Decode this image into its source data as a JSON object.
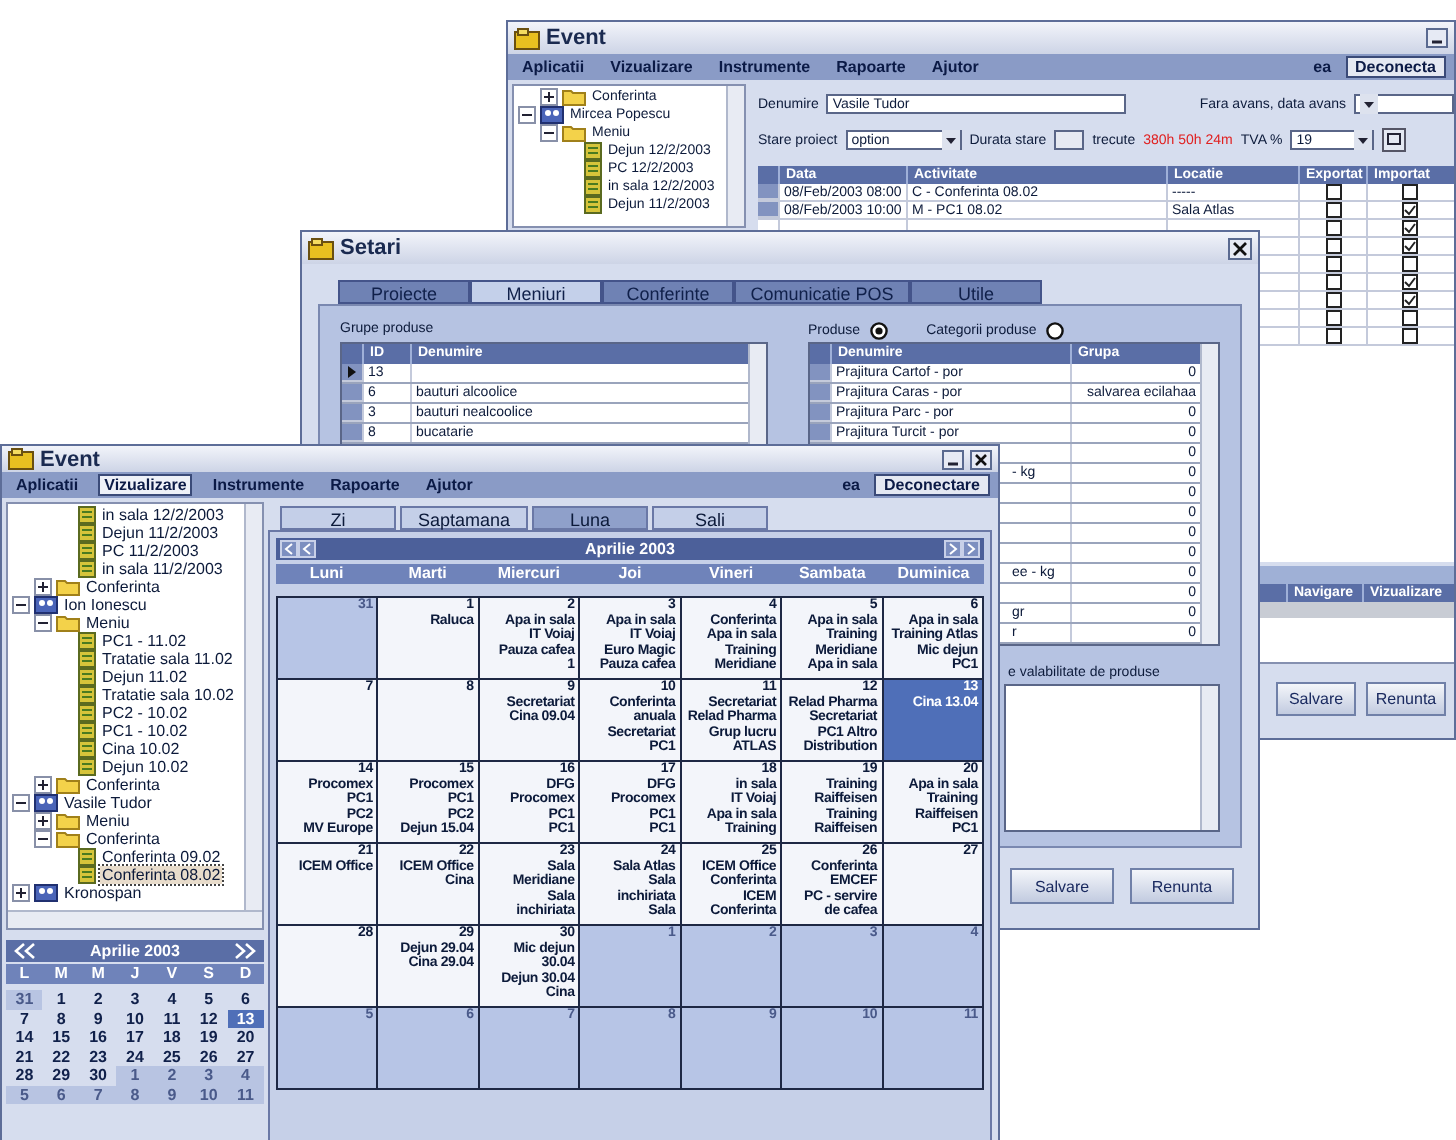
{
  "back_window": {
    "title": "Event",
    "menu": [
      {
        "label": "Aplicatii",
        "selected": false
      },
      {
        "label": "Vizualizare",
        "selected": false
      },
      {
        "label": "Instrumente",
        "selected": false
      },
      {
        "label": "Rapoarte",
        "selected": false
      },
      {
        "label": "Ajutor",
        "selected": false
      }
    ],
    "user": "ea",
    "logout_button": "Deconecta",
    "tree": [
      {
        "children": [
          {
            "label": "Conferinta",
            "kind": "folder",
            "expanded": false,
            "selected": false
          }
        ]
      },
      {
        "label": "Mircea Popescu",
        "kind": "person",
        "expanded": true,
        "selected": false,
        "children": [
          {
            "label": "Meniu",
            "kind": "folder",
            "expanded": true,
            "selected": false,
            "children": [
              {
                "label": "Dejun 12/2/2003",
                "kind": "item",
                "selected": false
              },
              {
                "label": "PC 12/2/2003",
                "kind": "item",
                "selected": false
              },
              {
                "label": "in sala 12/2/2003",
                "kind": "item",
                "selected": false
              },
              {
                "label": "Dejun 11/2/2003",
                "kind": "item",
                "selected": false
              }
            ]
          }
        ]
      }
    ],
    "form": {
      "name_label": "Denumire",
      "name_value": "Vasile Tudor",
      "advance_label": "Fara avans, data avans",
      "state_label": "Stare proiect",
      "state_value": "option",
      "duration_label": "Durata stare",
      "elapsed_label": "trecute",
      "elapsed_value": "380h 50h 24m",
      "vat_label": "TVA %",
      "vat_value": "19"
    },
    "table": {
      "columns": [
        "Data",
        "Activitate",
        "Locatie",
        "Exportat",
        "Importat"
      ],
      "rows": [
        {
          "date": "08/Feb/2003 08:00",
          "activity": "C - Conferinta 08.02",
          "location": "-----",
          "exported": false,
          "imported": false
        },
        {
          "date": "08/Feb/2003 10:00",
          "activity": "M - PC1 08.02",
          "location": "Sala Atlas",
          "exported": false,
          "imported": true
        },
        {
          "exported": false,
          "imported": true
        },
        {
          "exported": false,
          "imported": true
        },
        {
          "exported": false,
          "imported": false
        },
        {
          "exported": false,
          "imported": true
        },
        {
          "exported": false,
          "imported": true
        },
        {
          "exported": false,
          "imported": false
        },
        {
          "exported": false,
          "imported": false
        }
      ]
    },
    "lower_table": {
      "columns": [
        "Navigare",
        "Vizualizare"
      ]
    },
    "buttons": [
      "Salvare",
      "Renunta"
    ]
  },
  "settings_window": {
    "title": "Setari",
    "tabs": [
      {
        "label": "Proiecte",
        "selected": false
      },
      {
        "label": "Meniuri",
        "selected": true
      },
      {
        "label": "Conferinte",
        "selected": false
      },
      {
        "label": "Comunicatie POS",
        "selected": false
      },
      {
        "label": "Utile",
        "selected": false
      }
    ],
    "groups_label": "Grupe produse",
    "groups_table": {
      "columns": [
        "ID",
        "Denumire"
      ],
      "rows": [
        {
          "id": "13",
          "selected": true
        },
        {
          "id": "6",
          "name": "bauturi alcoolice",
          "selected": false
        },
        {
          "id": "3",
          "name": "bauturi nealcoolice",
          "selected": false
        },
        {
          "id": "8",
          "name": "bucatarie",
          "selected": false
        }
      ]
    },
    "radios": [
      {
        "label": "Produse",
        "selected": true
      },
      {
        "label": "Categorii produse",
        "selected": false
      }
    ],
    "products_table": {
      "columns": [
        "Denumire",
        "Grupa"
      ],
      "rows": [
        {
          "kind": "full",
          "name": "Prajitura Cartof - por",
          "group": "0"
        },
        {
          "kind": "full",
          "name": "Prajitura Caras - por",
          "group": "salvarea ecilahaa"
        },
        {
          "kind": "full",
          "name": "Prajitura Parc - por",
          "group": "0"
        },
        {
          "kind": "full",
          "name": "Prajitura Turcit - por",
          "group": "0"
        },
        {
          "kind": "full",
          "group": "0"
        },
        {
          "kind": "cut",
          "name": "- kg",
          "group": "0"
        },
        {
          "kind": "full",
          "group": "0"
        },
        {
          "kind": "full",
          "group": "0"
        },
        {
          "kind": "full",
          "group": "0"
        },
        {
          "kind": "full",
          "group": "0"
        },
        {
          "kind": "cut",
          "name": "ee - kg",
          "group": "0"
        },
        {
          "kind": "full",
          "group": "0"
        },
        {
          "kind": "cut",
          "name": "gr",
          "group": "0"
        },
        {
          "kind": "cut",
          "name": "r",
          "group": "0"
        }
      ]
    },
    "validity_label": "e valabilitate de produse",
    "buttons": [
      "Salvare",
      "Renunta"
    ]
  },
  "front_window": {
    "title": "Event",
    "menu": [
      {
        "label": "Aplicatii",
        "selected": false
      },
      {
        "label": "Vizualizare",
        "selected": true
      },
      {
        "label": "Instrumente",
        "selected": false
      },
      {
        "label": "Rapoarte",
        "selected": false
      },
      {
        "label": "Ajutor",
        "selected": false
      }
    ],
    "user": "ea",
    "logout_button": "Deconectare",
    "tree": [
      {
        "children": [
          {
            "children": [
              {
                "label": "in sala 12/2/2003",
                "kind": "item",
                "selected": false
              },
              {
                "label": "Dejun 11/2/2003",
                "kind": "item",
                "selected": false
              },
              {
                "label": "PC 11/2/2003",
                "kind": "item",
                "selected": false
              },
              {
                "label": "in sala 11/2/2003",
                "kind": "item",
                "selected": false
              }
            ]
          },
          {
            "label": "Conferinta",
            "kind": "folder",
            "expanded": false,
            "selected": false
          }
        ]
      },
      {
        "label": "Ion Ionescu",
        "kind": "person",
        "expanded": true,
        "selected": false,
        "children": [
          {
            "label": "Meniu",
            "kind": "folder",
            "expanded": true,
            "selected": false,
            "children": [
              {
                "label": "PC1 - 11.02",
                "kind": "item",
                "selected": false
              },
              {
                "label": "Tratatie sala 11.02",
                "kind": "item",
                "selected": false
              },
              {
                "label": "Dejun 11.02",
                "kind": "item",
                "selected": false
              },
              {
                "label": "Tratatie sala 10.02",
                "kind": "item",
                "selected": false
              },
              {
                "label": "PC2 - 10.02",
                "kind": "item",
                "selected": false
              },
              {
                "label": "PC1 - 10.02",
                "kind": "item",
                "selected": false
              },
              {
                "label": "Cina 10.02",
                "kind": "item",
                "selected": false
              },
              {
                "label": "Dejun 10.02",
                "kind": "item",
                "selected": false
              }
            ]
          },
          {
            "label": "Conferinta",
            "kind": "folder",
            "expanded": false,
            "selected": false
          }
        ]
      },
      {
        "label": "Vasile Tudor",
        "kind": "person",
        "expanded": true,
        "selected": false,
        "children": [
          {
            "label": "Meniu",
            "kind": "folder",
            "expanded": false,
            "selected": false
          },
          {
            "label": "Conferinta",
            "kind": "folder",
            "expanded": true,
            "selected": false,
            "children": [
              {
                "label": "Conferinta 09.02",
                "kind": "item",
                "selected": false
              },
              {
                "label": "Conferinta 08.02",
                "kind": "item",
                "selected": true
              }
            ]
          }
        ]
      },
      {
        "label": "Kronospan",
        "kind": "person",
        "expanded": false,
        "selected": false
      }
    ],
    "mini_calendar": {
      "title": "Aprilie 2003",
      "weekdays": [
        "L",
        "M",
        "M",
        "J",
        "V",
        "S",
        "D"
      ],
      "days": [
        {
          "day": "31",
          "kind": "other",
          "selected": false
        },
        {
          "day": "1",
          "kind": "month",
          "selected": false
        },
        {
          "day": "2",
          "kind": "month",
          "selected": false
        },
        {
          "day": "3",
          "kind": "month",
          "selected": false
        },
        {
          "day": "4",
          "kind": "month",
          "selected": false
        },
        {
          "day": "5",
          "kind": "month",
          "selected": false
        },
        {
          "day": "6",
          "kind": "month",
          "selected": false
        },
        {
          "day": "7",
          "kind": "month",
          "selected": false
        },
        {
          "day": "8",
          "kind": "month",
          "selected": false
        },
        {
          "day": "9",
          "kind": "month",
          "selected": false
        },
        {
          "day": "10",
          "kind": "month",
          "selected": false
        },
        {
          "day": "11",
          "kind": "month",
          "selected": false
        },
        {
          "day": "12",
          "kind": "month",
          "selected": false
        },
        {
          "day": "13",
          "kind": "month",
          "selected": true
        },
        {
          "day": "14",
          "kind": "month",
          "selected": false
        },
        {
          "day": "15",
          "kind": "month",
          "selected": false
        },
        {
          "day": "16",
          "kind": "month",
          "selected": false
        },
        {
          "day": "17",
          "kind": "month",
          "selected": false
        },
        {
          "day": "18",
          "kind": "month",
          "selected": false
        },
        {
          "day": "19",
          "kind": "month",
          "selected": false
        },
        {
          "day": "20",
          "kind": "month",
          "selected": false
        },
        {
          "day": "21",
          "kind": "month",
          "selected": false
        },
        {
          "day": "22",
          "kind": "month",
          "selected": false
        },
        {
          "day": "23",
          "kind": "month",
          "selected": false
        },
        {
          "day": "24",
          "kind": "month",
          "selected": false
        },
        {
          "day": "25",
          "kind": "month",
          "selected": false
        },
        {
          "day": "26",
          "kind": "month",
          "selected": false
        },
        {
          "day": "27",
          "kind": "month",
          "selected": false
        },
        {
          "day": "28",
          "kind": "month",
          "selected": false
        },
        {
          "day": "29",
          "kind": "month",
          "selected": false
        },
        {
          "day": "30",
          "kind": "month",
          "selected": false
        },
        {
          "day": "1",
          "kind": "other",
          "selected": false
        },
        {
          "day": "2",
          "kind": "other",
          "selected": false
        },
        {
          "day": "3",
          "kind": "other",
          "selected": false
        },
        {
          "day": "4",
          "kind": "other",
          "selected": false
        },
        {
          "day": "5",
          "kind": "other",
          "selected": false
        },
        {
          "day": "6",
          "kind": "other",
          "selected": false
        },
        {
          "day": "7",
          "kind": "other",
          "selected": false
        },
        {
          "day": "8",
          "kind": "other",
          "selected": false
        },
        {
          "day": "9",
          "kind": "other",
          "selected": false
        },
        {
          "day": "10",
          "kind": "other",
          "selected": false
        },
        {
          "day": "11",
          "kind": "other",
          "selected": false
        }
      ]
    },
    "view_tabs": [
      {
        "label": "Zi",
        "selected": false
      },
      {
        "label": "Saptamana",
        "selected": false
      },
      {
        "label": "Luna",
        "selected": true
      },
      {
        "label": "Sali",
        "selected": false
      }
    ],
    "calendar": {
      "title": "Aprilie 2003",
      "weekdays": [
        "Luni",
        "Marti",
        "Miercuri",
        "Joi",
        "Vineri",
        "Sambata",
        "Duminica"
      ],
      "cells": [
        {
          "day": "31",
          "kind": "other",
          "selected": false
        },
        {
          "day": "1",
          "kind": "month",
          "selected": false,
          "events": [
            "Raluca"
          ]
        },
        {
          "day": "2",
          "kind": "month",
          "selected": false,
          "events": [
            "Apa in sala",
            "IT Voiaj",
            "Pauza cafea",
            "1"
          ]
        },
        {
          "day": "3",
          "kind": "month",
          "selected": false,
          "events": [
            "Apa in sala",
            "IT Voiaj",
            "Euro Magic",
            "Pauza cafea"
          ]
        },
        {
          "day": "4",
          "kind": "month",
          "selected": false,
          "events": [
            "Conferinta",
            "Apa in sala",
            "Training",
            "Meridiane"
          ]
        },
        {
          "day": "5",
          "kind": "month",
          "selected": false,
          "events": [
            "Apa in sala",
            "Training",
            "Meridiane",
            "Apa in sala"
          ]
        },
        {
          "day": "6",
          "kind": "month",
          "selected": false,
          "events": [
            "Apa in sala",
            "Training Atlas",
            "Mic dejun",
            "PC1"
          ]
        },
        {
          "day": "7",
          "kind": "month",
          "selected": false
        },
        {
          "day": "8",
          "kind": "month",
          "selected": false
        },
        {
          "day": "9",
          "kind": "month",
          "selected": false,
          "events": [
            "Secretariat",
            "Cina 09.04"
          ]
        },
        {
          "day": "10",
          "kind": "month",
          "selected": false,
          "events": [
            "Conferinta",
            "anuala",
            "Secretariat",
            "PC1"
          ]
        },
        {
          "day": "11",
          "kind": "month",
          "selected": false,
          "events": [
            "Secretariat",
            "Relad Pharma",
            "Grup lucru",
            "ATLAS"
          ]
        },
        {
          "day": "12",
          "kind": "month",
          "selected": false,
          "events": [
            "Relad Pharma",
            "Secretariat",
            "PC1 Altro",
            "Distribution"
          ]
        },
        {
          "day": "13",
          "kind": "month",
          "selected": true,
          "events": [
            "Cina 13.04"
          ]
        },
        {
          "day": "14",
          "kind": "month",
          "selected": false,
          "events": [
            "Procomex",
            "PC1",
            "PC2",
            "MV Europe"
          ]
        },
        {
          "day": "15",
          "kind": "month",
          "selected": false,
          "events": [
            "Procomex",
            "PC1",
            "PC2",
            "Dejun 15.04"
          ]
        },
        {
          "day": "16",
          "kind": "month",
          "selected": false,
          "events": [
            "DFG",
            "Procomex",
            "PC1",
            "PC1"
          ]
        },
        {
          "day": "17",
          "kind": "month",
          "selected": false,
          "events": [
            "DFG",
            "Procomex",
            "PC1",
            "PC1"
          ]
        },
        {
          "day": "18",
          "kind": "month",
          "selected": false,
          "events": [
            "in sala",
            "IT Voiaj",
            "Apa in sala",
            "Training"
          ]
        },
        {
          "day": "19",
          "kind": "month",
          "selected": false,
          "events": [
            "Training",
            "Raiffeisen",
            "Training",
            "Raiffeisen"
          ]
        },
        {
          "day": "20",
          "kind": "month",
          "selected": false,
          "events": [
            "Apa in sala",
            "Training",
            "Raiffeisen",
            "PC1"
          ]
        },
        {
          "day": "21",
          "kind": "month",
          "selected": false,
          "events": [
            "ICEM Office"
          ]
        },
        {
          "day": "22",
          "kind": "month",
          "selected": false,
          "events": [
            "ICEM Office",
            "Cina"
          ]
        },
        {
          "day": "23",
          "kind": "month",
          "selected": false,
          "events": [
            "Sala",
            "Meridiane",
            "Sala",
            "inchiriata"
          ]
        },
        {
          "day": "24",
          "kind": "month",
          "selected": false,
          "events": [
            "Sala Atlas",
            "Sala",
            "inchiriata",
            "Sala"
          ]
        },
        {
          "day": "25",
          "kind": "month",
          "selected": false,
          "events": [
            "ICEM Office",
            "Conferinta",
            "ICEM",
            "Conferinta"
          ]
        },
        {
          "day": "26",
          "kind": "month",
          "selected": false,
          "events": [
            "Conferinta",
            "EMCEF",
            "PC - servire",
            "de cafea"
          ]
        },
        {
          "day": "27",
          "kind": "month",
          "selected": false
        },
        {
          "day": "28",
          "kind": "month",
          "selected": false
        },
        {
          "day": "29",
          "kind": "month",
          "selected": false,
          "events": [
            "Dejun 29.04",
            "Cina 29.04"
          ]
        },
        {
          "day": "30",
          "kind": "month",
          "selected": false,
          "events": [
            "Mic dejun",
            "30.04",
            "Dejun 30.04",
            "Cina"
          ]
        },
        {
          "day": "1",
          "kind": "other",
          "selected": false
        },
        {
          "day": "2",
          "kind": "other",
          "selected": false
        },
        {
          "day": "3",
          "kind": "other",
          "selected": false
        },
        {
          "day": "4",
          "kind": "other",
          "selected": false
        },
        {
          "day": "5",
          "kind": "other",
          "selected": false
        },
        {
          "day": "6",
          "kind": "other",
          "selected": false
        },
        {
          "day": "7",
          "kind": "other",
          "selected": false
        },
        {
          "day": "8",
          "kind": "other",
          "selected": false
        },
        {
          "day": "9",
          "kind": "other",
          "selected": false
        },
        {
          "day": "10",
          "kind": "other",
          "selected": false
        },
        {
          "day": "11",
          "kind": "other",
          "selected": false
        }
      ]
    }
  }
}
